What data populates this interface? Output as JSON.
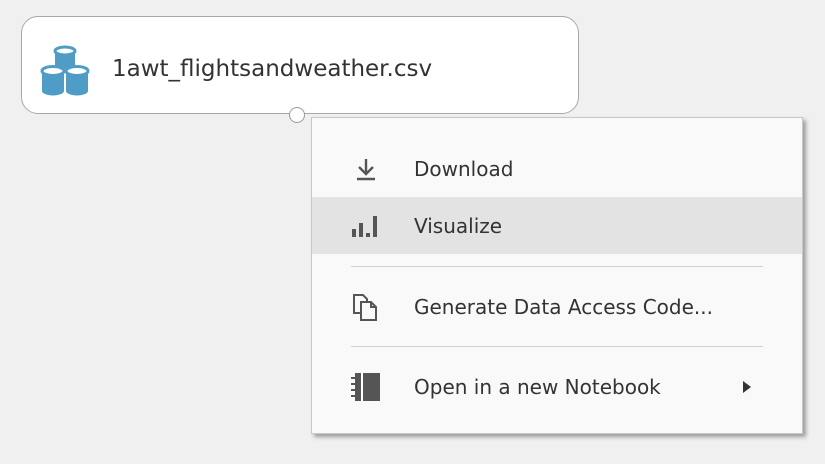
{
  "dataset": {
    "name": "1awt_flightsandweather.csv",
    "icon": "dataset-cylinders-icon",
    "icon_color": "#4f9dc7"
  },
  "context_menu": {
    "items": [
      {
        "label": "Download",
        "icon": "download-icon"
      },
      {
        "label": "Visualize",
        "icon": "bar-chart-icon",
        "highlighted": true
      },
      {
        "label": "Generate Data Access Code...",
        "icon": "copy-documents-icon"
      },
      {
        "label": "Open in a new Notebook",
        "icon": "notebook-icon",
        "has_submenu": true
      }
    ],
    "highlight_color": "#e3e3e3"
  }
}
